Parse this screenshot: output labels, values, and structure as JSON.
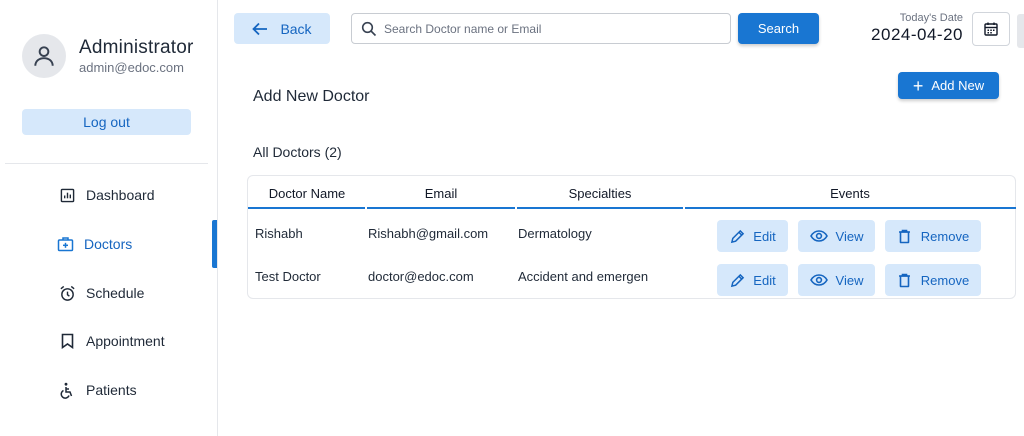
{
  "sidebar": {
    "admin_name": "Administrator",
    "admin_email": "admin@edoc.com",
    "logout_label": "Log out",
    "items": [
      {
        "label": "Dashboard",
        "icon": "dashboard-icon",
        "active": false
      },
      {
        "label": "Doctors",
        "icon": "medical-bag-icon",
        "active": true
      },
      {
        "label": "Schedule",
        "icon": "alarm-clock-icon",
        "active": false
      },
      {
        "label": "Appointment",
        "icon": "bookmark-icon",
        "active": false
      },
      {
        "label": "Patients",
        "icon": "wheelchair-icon",
        "active": false
      }
    ]
  },
  "header": {
    "back_label": "Back",
    "search_placeholder": "Search Doctor name or Email",
    "search_value": "",
    "search_button_label": "Search",
    "today_label": "Today's Date",
    "today_date": "2024-04-20"
  },
  "main": {
    "page_title": "Add New Doctor",
    "add_button_label": "Add New",
    "section_title": "All Doctors (2)",
    "table": {
      "columns": [
        "Doctor Name",
        "Email",
        "Specialties",
        "Events"
      ],
      "rows": [
        {
          "name": "Rishabh",
          "email": "Rishabh@gmail.com",
          "specialty": "Dermatology"
        },
        {
          "name": "Test Doctor",
          "email": "doctor@edoc.com",
          "specialty": "Accident and emergen"
        }
      ],
      "actions": {
        "edit": "Edit",
        "view": "View",
        "remove": "Remove"
      }
    }
  },
  "colors": {
    "accent": "#1976d2",
    "accent_light": "#d6e8fb",
    "accent_text": "#1565c0"
  }
}
